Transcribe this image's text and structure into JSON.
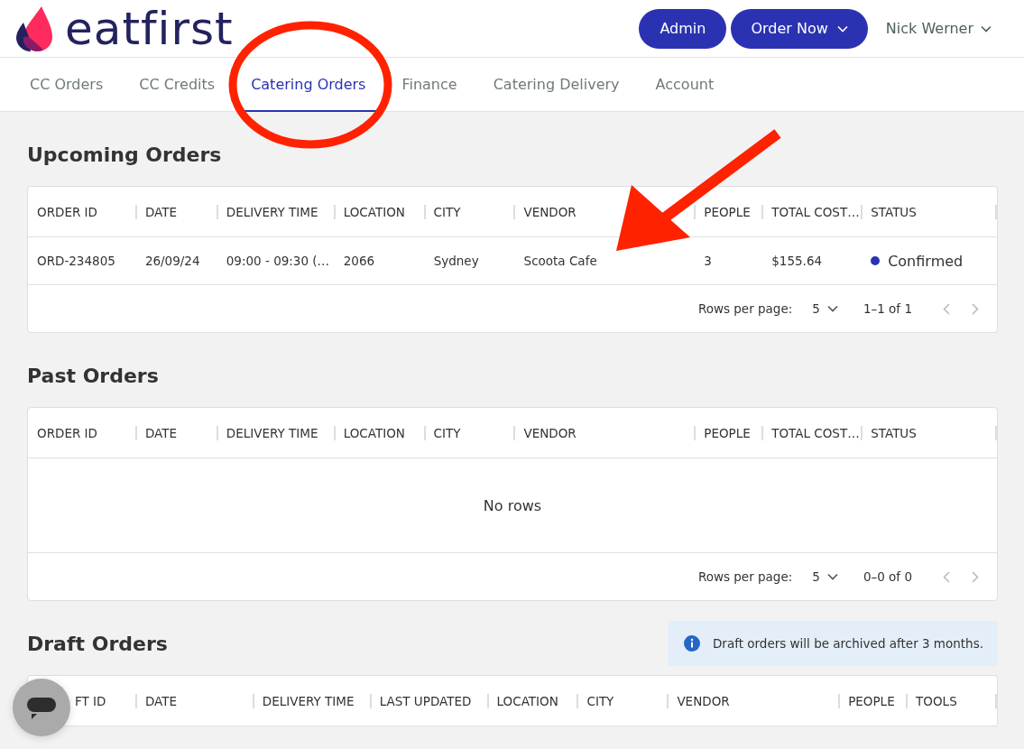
{
  "header": {
    "logo": "eatfirst",
    "buttons": [
      {
        "label": "Admin",
        "kind": "plain"
      },
      {
        "label": "Order Now",
        "kind": "dropdown"
      }
    ],
    "user": "Nick Werner"
  },
  "tabs": [
    {
      "label": "CC Orders",
      "selected": false
    },
    {
      "label": "CC Credits",
      "selected": false
    },
    {
      "label": "Catering Orders",
      "selected": true
    },
    {
      "label": "Finance",
      "selected": false
    },
    {
      "label": "Catering Delivery",
      "selected": false
    },
    {
      "label": "Account",
      "selected": false
    }
  ],
  "sections": [
    {
      "title": "Upcoming Orders",
      "table": {
        "columns": [
          "ORDER ID",
          "DATE",
          "DELIVERY TIME",
          "LOCATION",
          "CITY",
          "VENDOR",
          "PEOPLE",
          "TOTAL COST…",
          "STATUS"
        ],
        "rows": [
          {
            "cells": [
              "ORD-234805",
              "26/09/24",
              "09:00 - 09:30 (…",
              "2066",
              "Sydney",
              "Scoota Cafe",
              "3",
              "$155.64"
            ],
            "status": {
              "label": "Confirmed",
              "color": "#2b32b2"
            }
          }
        ],
        "footer": {
          "rows_per_page_label": "Rows per page:",
          "rows_per_page": "5",
          "range": "1–1 of 1"
        }
      }
    },
    {
      "title": "Past Orders",
      "table": {
        "columns": [
          "ORDER ID",
          "DATE",
          "DELIVERY TIME",
          "LOCATION",
          "CITY",
          "VENDOR",
          "PEOPLE",
          "TOTAL COST…",
          "STATUS"
        ],
        "empty_message": "No rows",
        "footer": {
          "rows_per_page_label": "Rows per page:",
          "rows_per_page": "5",
          "range": "0–0 of 0"
        }
      }
    },
    {
      "title": "Draft Orders",
      "notice": "Draft orders will be archived after 3 months.",
      "table": {
        "columns": [
          "FT ID",
          "DATE",
          "DELIVERY TIME",
          "LAST UPDATED",
          "LOCATION",
          "CITY",
          "VENDOR",
          "PEOPLE",
          "TOOLS"
        ]
      }
    }
  ]
}
